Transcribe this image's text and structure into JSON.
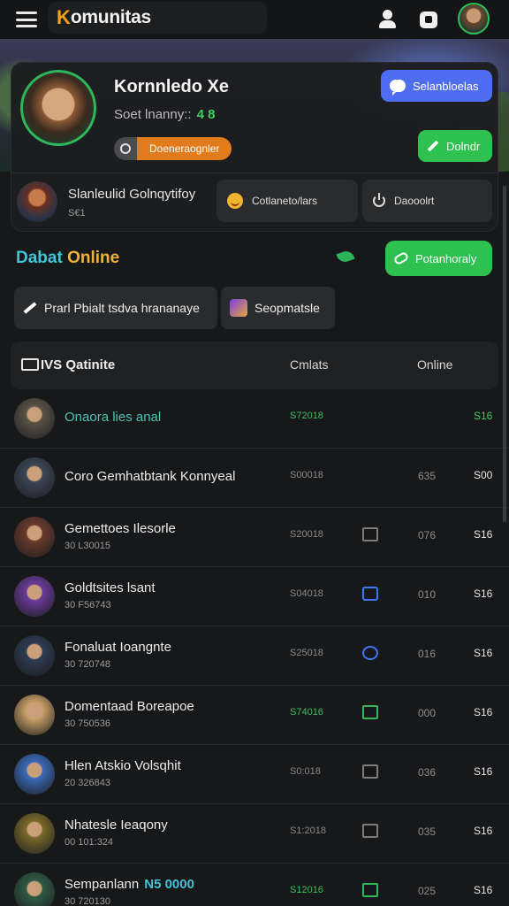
{
  "header": {
    "brand_first": "K",
    "brand_rest": "omunitas"
  },
  "profile": {
    "name": "Kornnledo Xe",
    "sub_label": "Soet lnanny::",
    "sub_number": "4 8",
    "badge_label": "Doeneraognler",
    "message_button": "Selanbloelas",
    "edit_button": "Dolndr",
    "mini_name": "Slanleulid Golnqytifoy",
    "mini_sub": "S€1",
    "stat_one": "Cotlaneto/lars",
    "stat_two": "Daooolrt"
  },
  "section": {
    "title_a": "Dabat",
    "title_b": "Online",
    "personal_button": "Potanhoraly",
    "chip_one": "Prarl Pbialt  tsdva hrananaye",
    "chip_two": "Seopmatsle"
  },
  "table": {
    "head_name": "IVS Qatinite",
    "head_col1": "Cmlats",
    "head_col2": "Online",
    "rows": [
      {
        "name": "Onaora lies anal",
        "sub": "",
        "c1": "S72018",
        "c3": "",
        "c4": "S16",
        "avatar": "#5a5246"
      },
      {
        "name": "Coro Gemhatbtank Konnyeal",
        "sub": "",
        "c1": "S00018",
        "c3": "635",
        "c4": "S00",
        "avatar": "#3c4656"
      },
      {
        "name": "Gemettoes Ilesorle",
        "sub": "30 L30015",
        "c1": "S20018",
        "c3": "076",
        "c4": "S16",
        "avatar": "#6a3a2c"
      },
      {
        "name": "Goldtsites lsant",
        "sub": "30 F56743",
        "c1": "S04018",
        "c3": "010",
        "c4": "S16",
        "avatar": "#6a3a9a"
      },
      {
        "name": "Fonaluat Ioangnte",
        "sub": "30 720748",
        "c1": "S25018",
        "c3": "016",
        "c4": "S16",
        "avatar": "#2e3b52"
      },
      {
        "name": "Domentaad Boreapoe",
        "sub": "30 750536",
        "c1": "S74016",
        "c3": "000",
        "c4": "S16",
        "avatar": "#c9a067"
      },
      {
        "name": "Hlen Atskio Volsqhit",
        "sub": "20 326843",
        "c1": "S0:018",
        "c3": "036",
        "c4": "S16",
        "avatar": "#3b6ab8"
      },
      {
        "name": "Nhatesle Ieaqony",
        "sub": "00 101:324",
        "c1": "S1:2018",
        "c3": "035",
        "c4": "S16",
        "avatar": "#7a6a2a"
      },
      {
        "name": "Sempanlann",
        "tag": "N5 0000",
        "sub": "30 720130",
        "c1": "S12016",
        "c3": "025",
        "c4": "S16",
        "avatar": "#2f5a44"
      }
    ]
  }
}
